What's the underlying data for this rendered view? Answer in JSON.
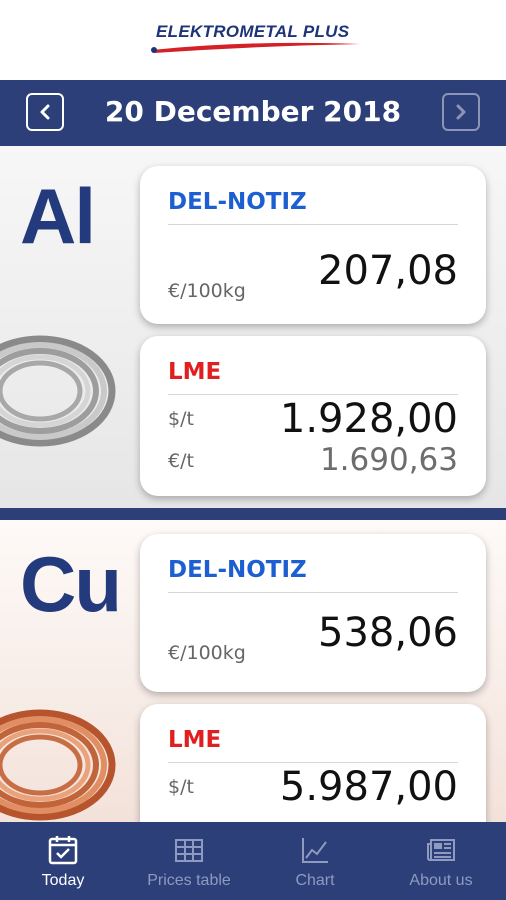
{
  "header": {
    "logo_text": "ELEKTROMETAL PLUS"
  },
  "date_bar": {
    "date": "20 December 2018"
  },
  "metals": [
    {
      "symbol": "Al",
      "del_notiz": {
        "label": "DEL-NOTIZ",
        "unit": "€/100kg",
        "value": "207,08"
      },
      "lme": {
        "label": "LME",
        "unit_usd": "$/t",
        "value_usd": "1.928,00",
        "unit_eur": "€/t",
        "value_eur": "1.690,63"
      }
    },
    {
      "symbol": "Cu",
      "del_notiz": {
        "label": "DEL-NOTIZ",
        "unit": "€/100kg",
        "value": "538,06"
      },
      "lme": {
        "label": "LME",
        "unit_usd": "$/t",
        "value_usd": "5.987,00"
      }
    }
  ],
  "tabs": [
    {
      "label": "Today",
      "icon": "calendar-icon",
      "active": true
    },
    {
      "label": "Prices table",
      "icon": "table-icon",
      "active": false
    },
    {
      "label": "Chart",
      "icon": "chart-icon",
      "active": false
    },
    {
      "label": "About us",
      "icon": "newspaper-icon",
      "active": false
    }
  ],
  "colors": {
    "brand_navy": "#2c3f79",
    "del_blue": "#1d5fd0",
    "lme_red": "#e02020"
  }
}
